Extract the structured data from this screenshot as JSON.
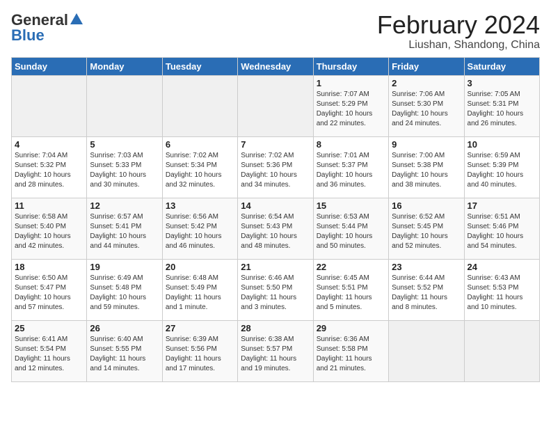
{
  "header": {
    "logo_general": "General",
    "logo_blue": "Blue",
    "month_year": "February 2024",
    "location": "Liushan, Shandong, China"
  },
  "weekdays": [
    "Sunday",
    "Monday",
    "Tuesday",
    "Wednesday",
    "Thursday",
    "Friday",
    "Saturday"
  ],
  "weeks": [
    [
      {
        "day": "",
        "info": ""
      },
      {
        "day": "",
        "info": ""
      },
      {
        "day": "",
        "info": ""
      },
      {
        "day": "",
        "info": ""
      },
      {
        "day": "1",
        "info": "Sunrise: 7:07 AM\nSunset: 5:29 PM\nDaylight: 10 hours\nand 22 minutes."
      },
      {
        "day": "2",
        "info": "Sunrise: 7:06 AM\nSunset: 5:30 PM\nDaylight: 10 hours\nand 24 minutes."
      },
      {
        "day": "3",
        "info": "Sunrise: 7:05 AM\nSunset: 5:31 PM\nDaylight: 10 hours\nand 26 minutes."
      }
    ],
    [
      {
        "day": "4",
        "info": "Sunrise: 7:04 AM\nSunset: 5:32 PM\nDaylight: 10 hours\nand 28 minutes."
      },
      {
        "day": "5",
        "info": "Sunrise: 7:03 AM\nSunset: 5:33 PM\nDaylight: 10 hours\nand 30 minutes."
      },
      {
        "day": "6",
        "info": "Sunrise: 7:02 AM\nSunset: 5:34 PM\nDaylight: 10 hours\nand 32 minutes."
      },
      {
        "day": "7",
        "info": "Sunrise: 7:02 AM\nSunset: 5:36 PM\nDaylight: 10 hours\nand 34 minutes."
      },
      {
        "day": "8",
        "info": "Sunrise: 7:01 AM\nSunset: 5:37 PM\nDaylight: 10 hours\nand 36 minutes."
      },
      {
        "day": "9",
        "info": "Sunrise: 7:00 AM\nSunset: 5:38 PM\nDaylight: 10 hours\nand 38 minutes."
      },
      {
        "day": "10",
        "info": "Sunrise: 6:59 AM\nSunset: 5:39 PM\nDaylight: 10 hours\nand 40 minutes."
      }
    ],
    [
      {
        "day": "11",
        "info": "Sunrise: 6:58 AM\nSunset: 5:40 PM\nDaylight: 10 hours\nand 42 minutes."
      },
      {
        "day": "12",
        "info": "Sunrise: 6:57 AM\nSunset: 5:41 PM\nDaylight: 10 hours\nand 44 minutes."
      },
      {
        "day": "13",
        "info": "Sunrise: 6:56 AM\nSunset: 5:42 PM\nDaylight: 10 hours\nand 46 minutes."
      },
      {
        "day": "14",
        "info": "Sunrise: 6:54 AM\nSunset: 5:43 PM\nDaylight: 10 hours\nand 48 minutes."
      },
      {
        "day": "15",
        "info": "Sunrise: 6:53 AM\nSunset: 5:44 PM\nDaylight: 10 hours\nand 50 minutes."
      },
      {
        "day": "16",
        "info": "Sunrise: 6:52 AM\nSunset: 5:45 PM\nDaylight: 10 hours\nand 52 minutes."
      },
      {
        "day": "17",
        "info": "Sunrise: 6:51 AM\nSunset: 5:46 PM\nDaylight: 10 hours\nand 54 minutes."
      }
    ],
    [
      {
        "day": "18",
        "info": "Sunrise: 6:50 AM\nSunset: 5:47 PM\nDaylight: 10 hours\nand 57 minutes."
      },
      {
        "day": "19",
        "info": "Sunrise: 6:49 AM\nSunset: 5:48 PM\nDaylight: 10 hours\nand 59 minutes."
      },
      {
        "day": "20",
        "info": "Sunrise: 6:48 AM\nSunset: 5:49 PM\nDaylight: 11 hours\nand 1 minute."
      },
      {
        "day": "21",
        "info": "Sunrise: 6:46 AM\nSunset: 5:50 PM\nDaylight: 11 hours\nand 3 minutes."
      },
      {
        "day": "22",
        "info": "Sunrise: 6:45 AM\nSunset: 5:51 PM\nDaylight: 11 hours\nand 5 minutes."
      },
      {
        "day": "23",
        "info": "Sunrise: 6:44 AM\nSunset: 5:52 PM\nDaylight: 11 hours\nand 8 minutes."
      },
      {
        "day": "24",
        "info": "Sunrise: 6:43 AM\nSunset: 5:53 PM\nDaylight: 11 hours\nand 10 minutes."
      }
    ],
    [
      {
        "day": "25",
        "info": "Sunrise: 6:41 AM\nSunset: 5:54 PM\nDaylight: 11 hours\nand 12 minutes."
      },
      {
        "day": "26",
        "info": "Sunrise: 6:40 AM\nSunset: 5:55 PM\nDaylight: 11 hours\nand 14 minutes."
      },
      {
        "day": "27",
        "info": "Sunrise: 6:39 AM\nSunset: 5:56 PM\nDaylight: 11 hours\nand 17 minutes."
      },
      {
        "day": "28",
        "info": "Sunrise: 6:38 AM\nSunset: 5:57 PM\nDaylight: 11 hours\nand 19 minutes."
      },
      {
        "day": "29",
        "info": "Sunrise: 6:36 AM\nSunset: 5:58 PM\nDaylight: 11 hours\nand 21 minutes."
      },
      {
        "day": "",
        "info": ""
      },
      {
        "day": "",
        "info": ""
      }
    ]
  ]
}
